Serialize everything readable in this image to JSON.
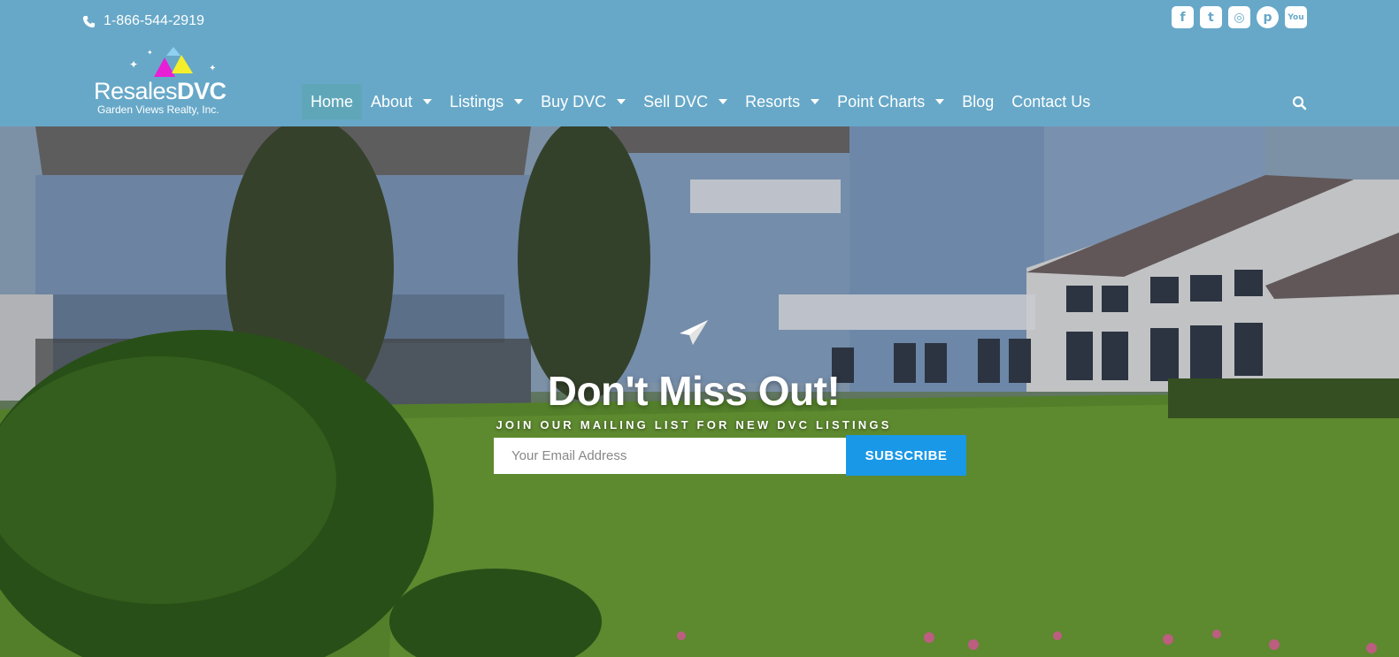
{
  "header": {
    "phone": "1-866-544-2919",
    "logo": {
      "word_light": "Resales",
      "word_bold": "DVC",
      "tagline": "Garden Views Realty, Inc."
    },
    "social": [
      {
        "icon": "facebook-icon",
        "glyph": "f"
      },
      {
        "icon": "twitter-icon",
        "glyph": "t"
      },
      {
        "icon": "instagram-icon",
        "glyph": "◎"
      },
      {
        "icon": "pinterest-icon",
        "glyph": "p"
      },
      {
        "icon": "youtube-icon",
        "glyph": "You"
      }
    ],
    "nav": [
      {
        "label": "Home",
        "active": true,
        "dropdown": false
      },
      {
        "label": "About",
        "dropdown": true
      },
      {
        "label": "Listings",
        "dropdown": true
      },
      {
        "label": "Buy DVC",
        "dropdown": true
      },
      {
        "label": "Sell DVC",
        "dropdown": true
      },
      {
        "label": "Resorts",
        "dropdown": true
      },
      {
        "label": "Point Charts",
        "dropdown": true
      },
      {
        "label": "Blog",
        "dropdown": false
      },
      {
        "label": "Contact Us",
        "dropdown": false
      }
    ]
  },
  "hero": {
    "title": "Don't Miss Out!",
    "subtitle": "JOIN OUR MAILING LIST FOR NEW DVC LISTINGS",
    "email_placeholder": "Your Email Address",
    "subscribe_label": "SUBSCRIBE"
  },
  "colors": {
    "header_bg": "#67a8c8",
    "active_nav": "#5fa7b8",
    "button": "#1a98e8"
  }
}
